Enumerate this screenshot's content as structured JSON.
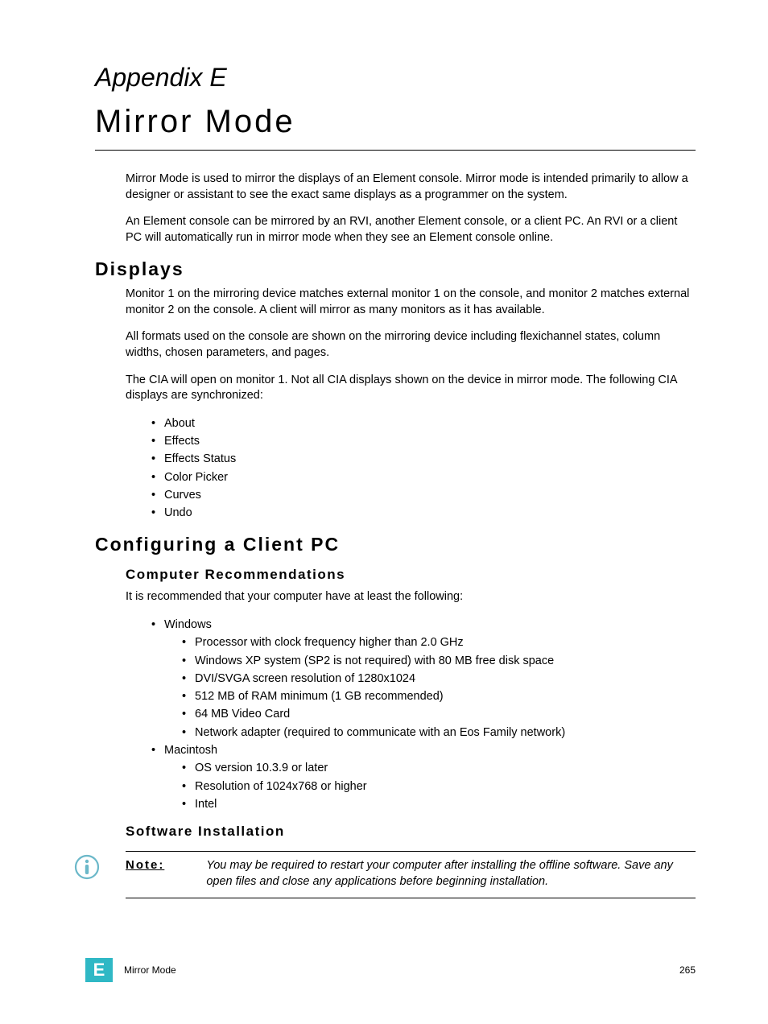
{
  "appendix_label": "Appendix E",
  "main_title": "Mirror Mode",
  "intro": {
    "p1": "Mirror Mode is used to mirror the displays of an Element console. Mirror mode is intended primarily to allow a designer or assistant to see the exact same displays as a programmer on the system.",
    "p2": "An Element console can be mirrored by an RVI, another Element console, or a client PC. An RVI or a client PC will automatically run in mirror mode when they see an Element console online."
  },
  "displays": {
    "heading": "Displays",
    "p1": "Monitor 1 on the mirroring device matches external monitor 1 on the console, and monitor 2 matches external monitor 2 on the console. A client will mirror as many monitors as it has available.",
    "p2": "All formats used on the console are shown on the mirroring device including flexichannel states, column widths, chosen parameters, and pages.",
    "p3": "The CIA will open on monitor 1. Not all CIA displays shown on the device in mirror mode. The following CIA displays are synchronized:",
    "items": [
      "About",
      "Effects",
      "Effects Status",
      "Color Picker",
      "Curves",
      "Undo"
    ]
  },
  "configuring": {
    "heading": "Configuring a Client PC",
    "recommendations": {
      "heading": "Computer Recommendations",
      "intro": "It is recommended that your computer have at least the following:",
      "windows": {
        "label": "Windows",
        "items": [
          "Processor with clock frequency higher than 2.0 GHz",
          "Windows XP system (SP2 is not required) with 80 MB free disk space",
          "DVI/SVGA screen resolution of 1280x1024",
          "512 MB of RAM minimum (1 GB recommended)",
          "64 MB Video Card",
          "Network adapter (required to communicate with an Eos Family network)"
        ]
      },
      "macintosh": {
        "label": "Macintosh",
        "items": [
          "OS version 10.3.9 or later",
          "Resolution of 1024x768 or higher",
          "Intel"
        ]
      }
    },
    "installation": {
      "heading": "Software Installation",
      "note_label": "Note:",
      "note_text": "You may be required to restart your computer after installing the offline software. Save any open files and close any applications before beginning installation."
    }
  },
  "footer": {
    "badge": "E",
    "title": "Mirror Mode",
    "page": "265"
  }
}
